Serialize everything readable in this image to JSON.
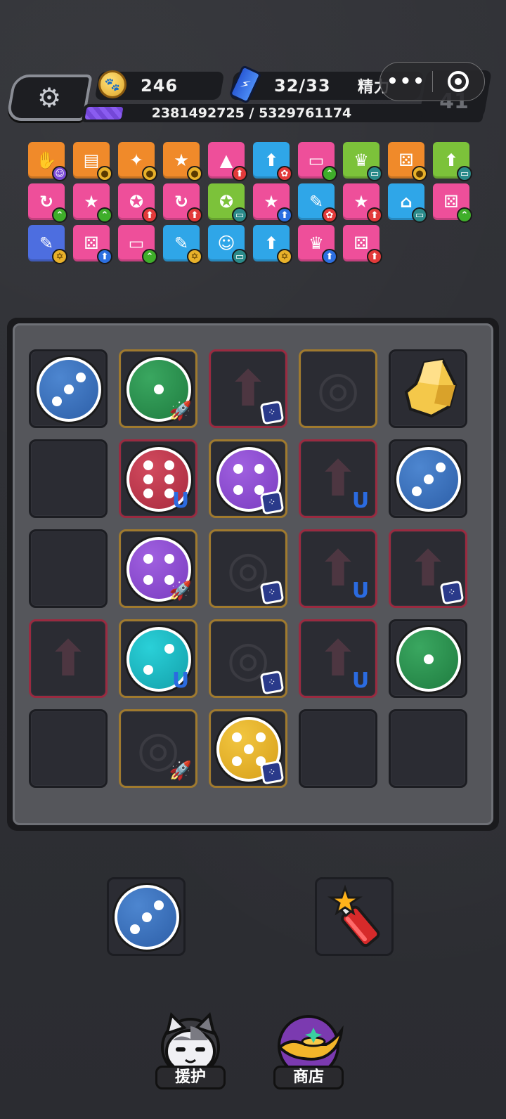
{
  "hud": {
    "coins": "246",
    "energy": "32/33",
    "energy_label": "精力",
    "xp_text": "2381492725 / 5329761174",
    "xp_progress": 0.1,
    "level": "41",
    "capsule_dots": "•••"
  },
  "buffs": [
    {
      "color": "orange",
      "icon": "throw-hand-icon",
      "badge": "cat-icon",
      "badge_color": "purple"
    },
    {
      "color": "orange",
      "icon": "dice-card-icon",
      "badge": "coin-icon",
      "badge_color": "gold"
    },
    {
      "color": "orange",
      "icon": "stars-icon",
      "badge": "coin-icon",
      "badge_color": "gold"
    },
    {
      "color": "orange",
      "icon": "star-2-icon",
      "badge": "coin-icon",
      "badge_color": "gold"
    },
    {
      "color": "pink",
      "icon": "gold-bars-icon",
      "badge": "arrow-up-icon",
      "badge_color": "red"
    },
    {
      "color": "blue",
      "icon": "arrow-up-icon",
      "badge": "paw-icon",
      "badge_color": "red"
    },
    {
      "color": "pink",
      "icon": "card-icon",
      "badge": "double-chevron-icon",
      "badge_color": "green"
    },
    {
      "color": "green",
      "icon": "crown-icon",
      "badge": "card-icon",
      "badge_color": "teal"
    },
    {
      "color": "orange",
      "icon": "dice-icon",
      "badge": "coin-icon",
      "badge_color": "gold"
    },
    {
      "color": "green",
      "icon": "arrow-up-icon",
      "badge": "card-icon",
      "badge_color": "teal"
    },
    {
      "color": "pink",
      "icon": "refresh-icon",
      "badge": "double-chevron-icon",
      "badge_color": "green"
    },
    {
      "color": "pink",
      "icon": "star-2-icon",
      "badge": "double-chevron-icon",
      "badge_color": "green"
    },
    {
      "color": "pink",
      "icon": "medal-icon",
      "badge": "arrow-up-icon",
      "badge_color": "red"
    },
    {
      "color": "pink",
      "icon": "refresh-icon",
      "badge": "arrow-up-icon",
      "badge_color": "red"
    },
    {
      "color": "green",
      "icon": "medal-icon",
      "badge": "card-icon",
      "badge_color": "teal"
    },
    {
      "color": "pink",
      "icon": "star-4-icon",
      "badge": "arrow-up-icon",
      "badge_color": "blue"
    },
    {
      "color": "blue",
      "icon": "firecracker-icon",
      "badge": "paw-icon",
      "badge_color": "red"
    },
    {
      "color": "pink",
      "icon": "star-3-icon",
      "badge": "arrow-up-icon",
      "badge_color": "red"
    },
    {
      "color": "blue",
      "icon": "garage-icon",
      "badge": "card-icon",
      "badge_color": "teal"
    },
    {
      "color": "pink",
      "icon": "dice-icon",
      "badge": "double-chevron-icon",
      "badge_color": "green"
    },
    {
      "color": "indigo",
      "icon": "firecracker-icon",
      "badge": "hex-coin-icon",
      "badge_color": "gold"
    },
    {
      "color": "pink",
      "icon": "dice-icon",
      "badge": "arrow-up-icon",
      "badge_color": "blue"
    },
    {
      "color": "pink",
      "icon": "card-icon",
      "badge": "double-chevron-icon",
      "badge_color": "green"
    },
    {
      "color": "blue",
      "icon": "firecracker-icon",
      "badge": "hex-coin-icon",
      "badge_color": "gold"
    },
    {
      "color": "blue",
      "icon": "cat-icon",
      "badge": "card-icon",
      "badge_color": "teal"
    },
    {
      "color": "blue",
      "icon": "arrow-up-icon",
      "badge": "hex-coin-icon",
      "badge_color": "gold"
    },
    {
      "color": "pink",
      "icon": "crown-icon",
      "badge": "arrow-up-icon",
      "badge_color": "blue"
    },
    {
      "color": "pink",
      "icon": "dice-icon",
      "badge": "arrow-up-icon",
      "badge_color": "red"
    }
  ],
  "board": [
    [
      {
        "frame": "none",
        "die": "blue",
        "pips": 3
      },
      {
        "frame": "gold",
        "die": "green",
        "pips": 1,
        "mod": "rocket"
      },
      {
        "frame": "red",
        "ghost": "arrow",
        "mod": "dice"
      },
      {
        "frame": "gold",
        "ghost": "bag"
      },
      {
        "frame": "none",
        "item": "gold-nugget"
      }
    ],
    [
      {
        "frame": "none"
      },
      {
        "frame": "red",
        "die": "red",
        "pips": 6,
        "mod": "magnet"
      },
      {
        "frame": "gold",
        "die": "purple",
        "pips": 4,
        "mod": "dice"
      },
      {
        "frame": "red",
        "ghost": "arrow",
        "mod": "magnet"
      },
      {
        "frame": "none",
        "die": "blue",
        "pips": 3
      }
    ],
    [
      {
        "frame": "none"
      },
      {
        "frame": "gold",
        "die": "purple",
        "pips": 4,
        "mod": "rocket"
      },
      {
        "frame": "gold",
        "ghost": "bag",
        "mod": "dice"
      },
      {
        "frame": "red",
        "ghost": "arrow",
        "mod": "magnet"
      },
      {
        "frame": "red",
        "ghost": "arrow",
        "mod": "dice"
      }
    ],
    [
      {
        "frame": "red",
        "ghost": "arrow"
      },
      {
        "frame": "gold",
        "die": "cyan",
        "pips": 2,
        "mod": "magnet"
      },
      {
        "frame": "gold",
        "ghost": "bag",
        "mod": "dice"
      },
      {
        "frame": "red",
        "ghost": "arrow",
        "mod": "magnet"
      },
      {
        "frame": "none",
        "die": "green",
        "pips": 1
      }
    ],
    [
      {
        "frame": "none"
      },
      {
        "frame": "gold",
        "ghost": "bag",
        "mod": "rocket"
      },
      {
        "frame": "gold",
        "die": "yellow",
        "pips": 5,
        "mod": "dice"
      },
      {
        "frame": "none"
      },
      {
        "frame": "none"
      }
    ]
  ],
  "tray": {
    "left_slot": {
      "die": "blue",
      "pips": 3
    },
    "right_slot": {
      "item": "firecracker"
    }
  },
  "nav": {
    "assist_label": "援护",
    "shop_label": "商店"
  }
}
